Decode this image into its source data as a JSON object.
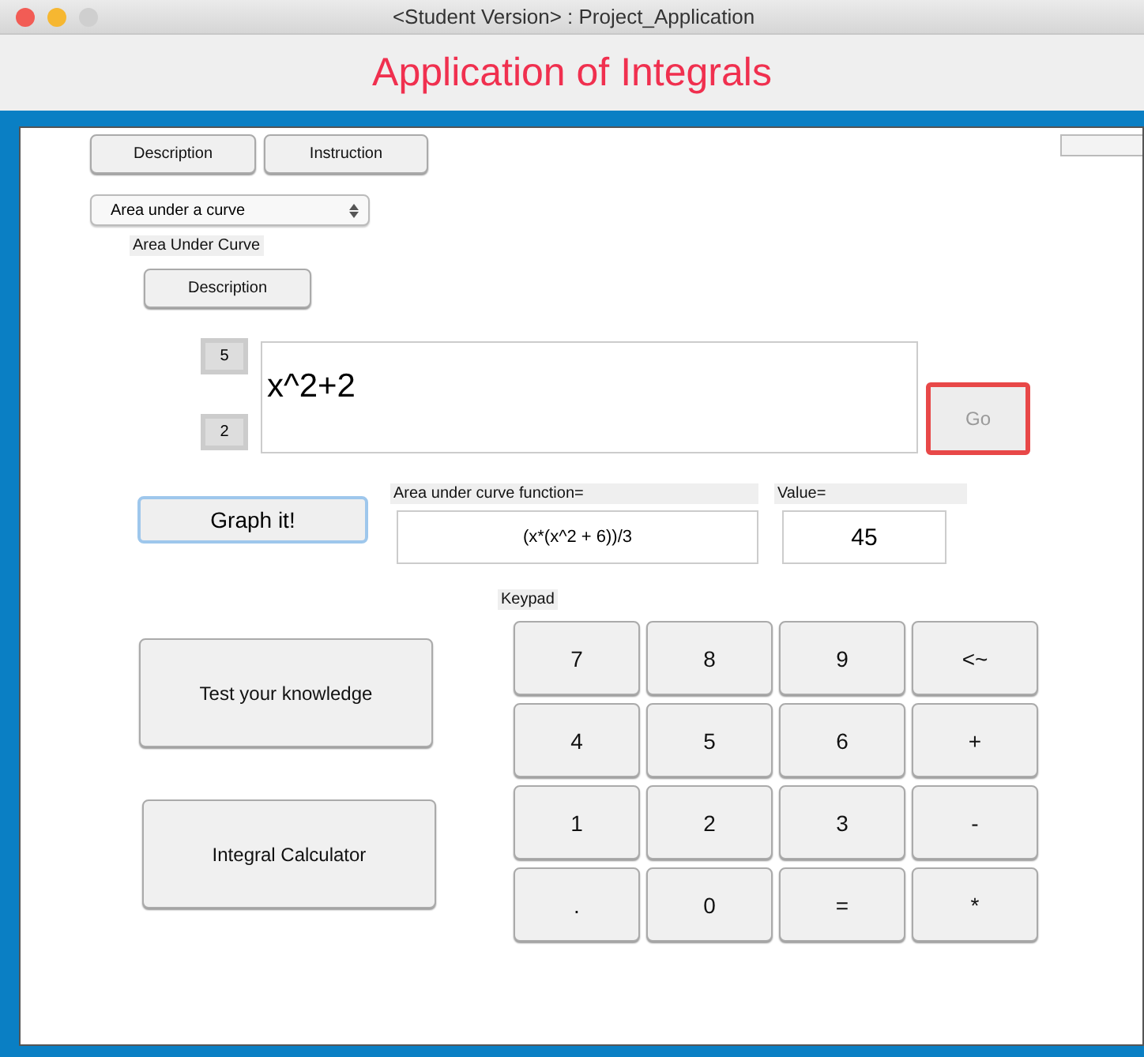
{
  "window": {
    "title": "<Student Version> : Project_Application"
  },
  "header": {
    "title": "Application of Integrals"
  },
  "top_buttons": [
    "Description",
    "Instruction"
  ],
  "mode_select": {
    "value": "Area under a curve"
  },
  "section_label": "Area Under Curve",
  "section_button": "Description",
  "limits": {
    "upper": "5",
    "lower": "2"
  },
  "expression": {
    "value": "x^2+2"
  },
  "go_button": {
    "label": "Go",
    "disabled": true
  },
  "graph_button": "Graph it!",
  "result": {
    "function_label": "Area under curve function=",
    "function_value": "(x*(x^2 + 6))/3",
    "value_label": "Value=",
    "value": "45"
  },
  "side_buttons": [
    "Test your knowledge",
    "Integral Calculator"
  ],
  "keypad": {
    "label": "Keypad",
    "keys": [
      "7",
      "8",
      "9",
      "<~",
      "4",
      "5",
      "6",
      "+",
      "1",
      "2",
      "3",
      "-",
      ".",
      "0",
      "=",
      "*"
    ]
  }
}
